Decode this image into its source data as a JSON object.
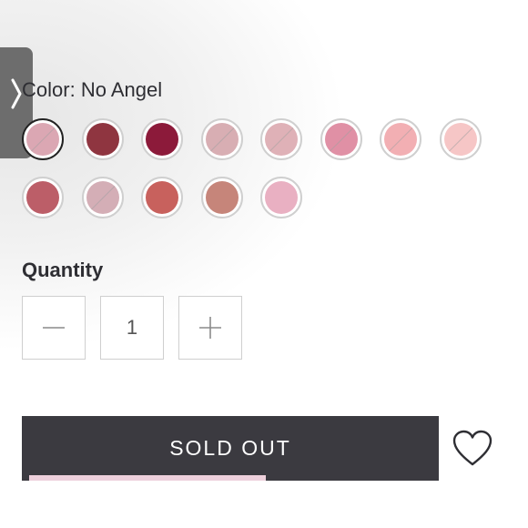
{
  "color": {
    "label": "Color:",
    "value": "No Angel"
  },
  "swatches": [
    {
      "name": "No Angel",
      "color": "#dba7b3",
      "selected": true,
      "slash": true
    },
    {
      "name": "swatch-2",
      "color": "#8f3540",
      "selected": false,
      "slash": false
    },
    {
      "name": "swatch-3",
      "color": "#8c1a3a",
      "selected": false,
      "slash": false
    },
    {
      "name": "swatch-4",
      "color": "#d8aeb3",
      "selected": false,
      "slash": true
    },
    {
      "name": "swatch-5",
      "color": "#dfb1b7",
      "selected": false,
      "slash": true
    },
    {
      "name": "swatch-6",
      "color": "#e090a5",
      "selected": false,
      "slash": true
    },
    {
      "name": "swatch-7",
      "color": "#f2afb3",
      "selected": false,
      "slash": true
    },
    {
      "name": "swatch-8",
      "color": "#f6c6c6",
      "selected": false,
      "slash": true
    },
    {
      "name": "swatch-9",
      "color": "#bc5e68",
      "selected": false,
      "slash": false
    },
    {
      "name": "swatch-10",
      "color": "#d4aeb6",
      "selected": false,
      "slash": true
    },
    {
      "name": "swatch-11",
      "color": "#c8615d",
      "selected": false,
      "slash": false
    },
    {
      "name": "swatch-12",
      "color": "#c6857a",
      "selected": false,
      "slash": false
    },
    {
      "name": "swatch-13",
      "color": "#e9b0c2",
      "selected": false,
      "slash": false
    }
  ],
  "quantity": {
    "label": "Quantity",
    "value": "1",
    "minus": "−",
    "plus": "+"
  },
  "cart": {
    "button_label": "SOLD OUT"
  },
  "icons": {
    "side_tab": "chevron-right-icon",
    "wishlist": "heart-icon"
  },
  "colors": {
    "button_bg": "#3b3a40",
    "side_tab": "#6d6d6d",
    "accent_bar": "#eed0dc"
  }
}
